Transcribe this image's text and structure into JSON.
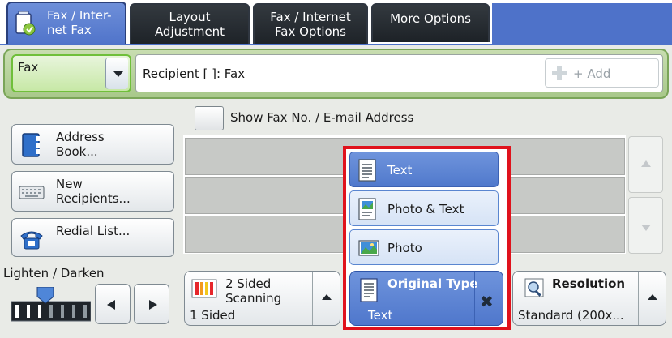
{
  "tabs": [
    {
      "label": "Fax / Inter-\nnet Fax",
      "active": true
    },
    {
      "label": "Layout\nAdjustment",
      "active": false
    },
    {
      "label": "Fax / Internet\nFax Options",
      "active": false
    },
    {
      "label": "More Options",
      "active": false
    }
  ],
  "recipient": {
    "type_value": "Fax",
    "field_text": "Recipient [   ]: Fax",
    "add_label": "+ Add"
  },
  "show_fax_label": "Show Fax No. / E-mail Address",
  "side_buttons": {
    "address_book": "Address\nBook...",
    "new_recipients": "New\nRecipients...",
    "redial_list": "Redial List..."
  },
  "lighten_darken_label": "Lighten / Darken",
  "lighten_darken_level": 3,
  "lighten_darken_steps": 7,
  "features": {
    "two_sided": {
      "title": "2 Sided\nScanning",
      "value": "1 Sided"
    },
    "original_type": {
      "title": "Original Type",
      "value": "Text"
    },
    "resolution": {
      "title": "Resolution",
      "value": "Standard (200x..."
    }
  },
  "original_type_options": [
    {
      "label": "Text",
      "selected": true
    },
    {
      "label": "Photo & Text",
      "selected": false
    },
    {
      "label": "Photo",
      "selected": false
    }
  ],
  "colors": {
    "accent_blue": "#5079cc",
    "highlight_red": "#e0121c",
    "recipient_green": "#a8c88a"
  }
}
